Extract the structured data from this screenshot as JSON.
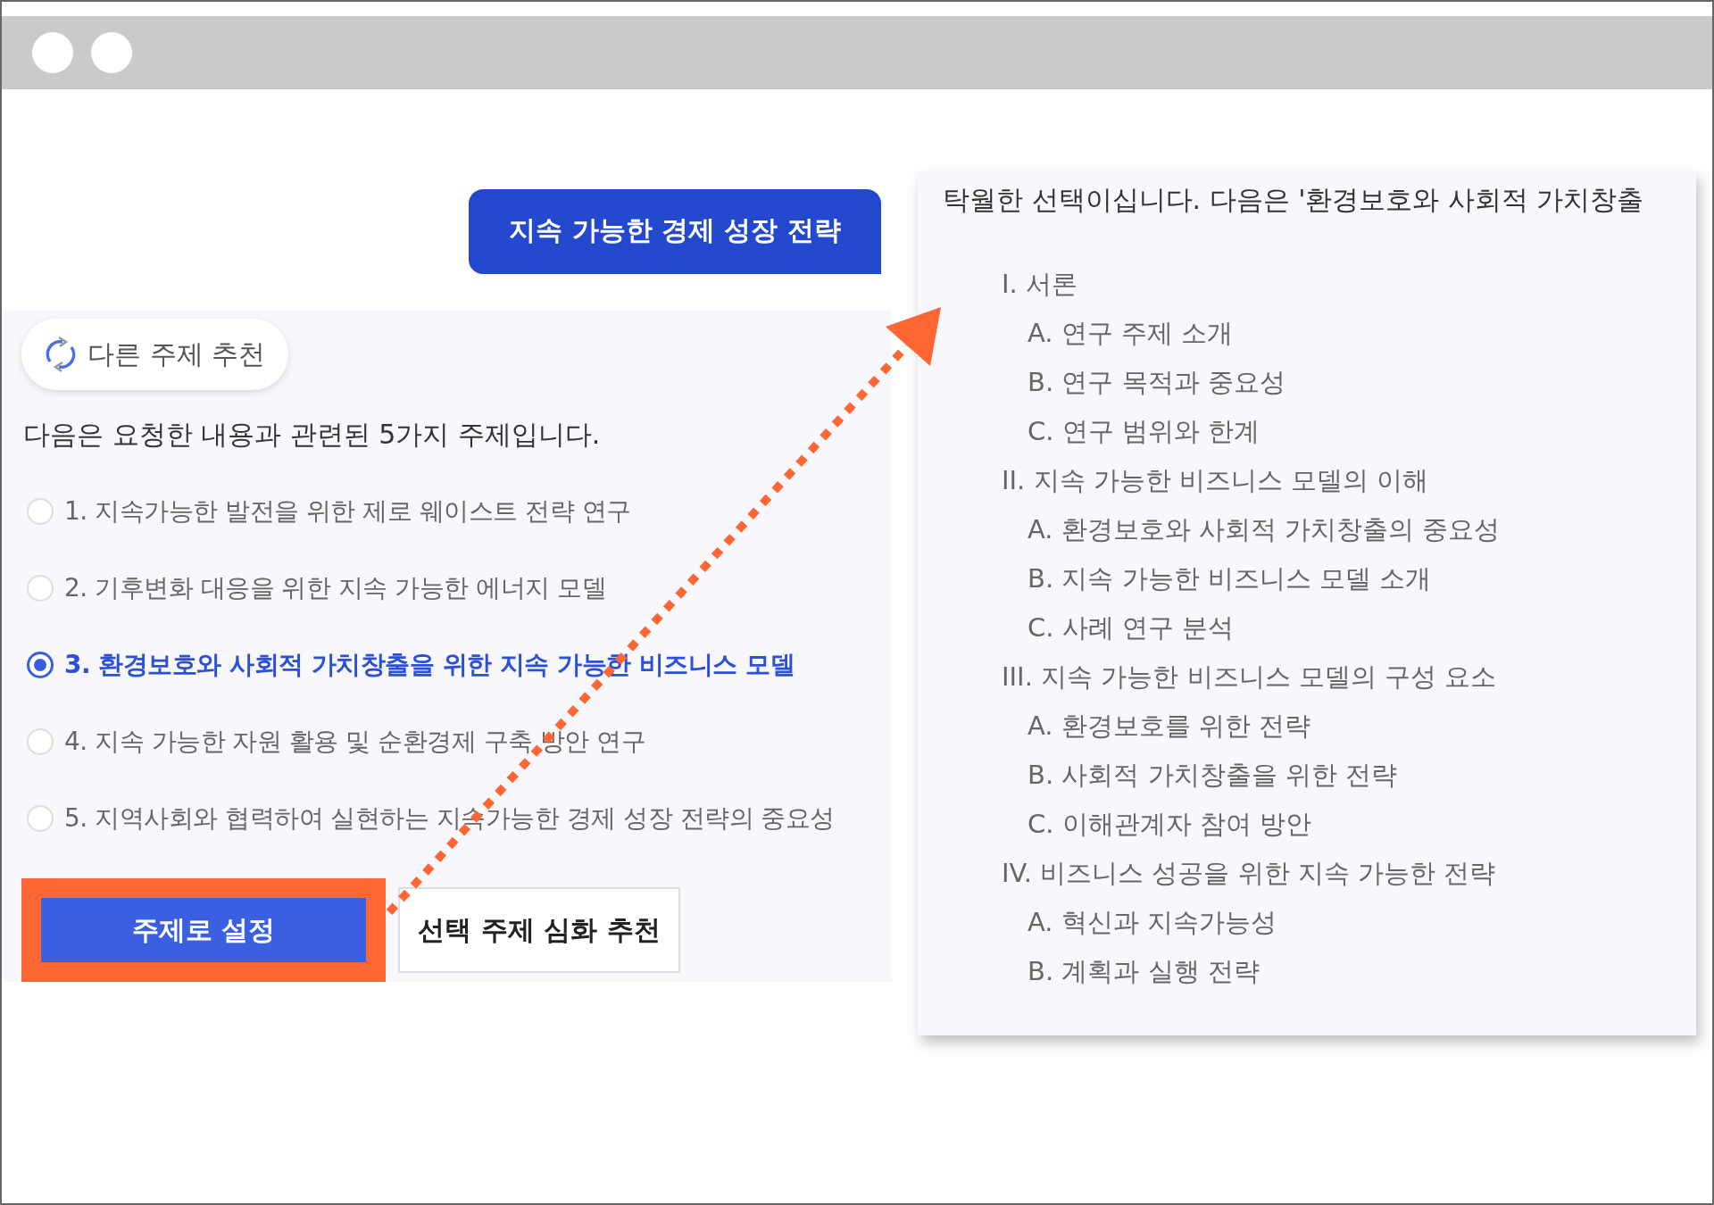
{
  "user_message": {
    "text": "지속 가능한 경제 성장 전략"
  },
  "topic_panel": {
    "refresh_button": "다른 주제 추천",
    "intro": "다음은 요청한 내용과 관련된 5가지 주제입니다.",
    "options": [
      {
        "label": "1. 지속가능한 발전을 위한 제로 웨이스트 전략 연구",
        "selected": false
      },
      {
        "label": "2. 기후변화 대응을 위한 지속 가능한 에너지 모델",
        "selected": false
      },
      {
        "label": "3. 환경보호와 사회적 가치창출을 위한 지속 가능한 비즈니스 모델",
        "selected": true
      },
      {
        "label": "4. 지속 가능한 자원 활용 및 순환경제 구축 방안 연구",
        "selected": false
      },
      {
        "label": "5. 지역사회와 협력하여 실현하는 지속가능한 경제 성장 전략의 중요성",
        "selected": false
      }
    ],
    "buttons": [
      {
        "label": "주제로 설정",
        "kind": "primary",
        "highlighted": true
      },
      {
        "label": "선택 주제 심화 추천",
        "kind": "secondary",
        "highlighted": false
      }
    ]
  },
  "outline_panel": {
    "intro": "탁월한 선택이십니다. 다음은 '환경보호와 사회적 가치창출",
    "outline": [
      {
        "label": "I. 서론",
        "children": [
          {
            "label": "A. 연구 주제 소개"
          },
          {
            "label": "B. 연구 목적과 중요성"
          },
          {
            "label": "C. 연구 범위와 한계"
          }
        ]
      },
      {
        "label": "II. 지속 가능한 비즈니스 모델의 이해",
        "children": [
          {
            "label": "A. 환경보호와 사회적 가치창출의 중요성"
          },
          {
            "label": "B. 지속 가능한 비즈니스 모델 소개"
          },
          {
            "label": "C. 사례 연구 분석"
          }
        ]
      },
      {
        "label": "III. 지속 가능한 비즈니스 모델의 구성 요소",
        "children": [
          {
            "label": "A. 환경보호를 위한 전략"
          },
          {
            "label": "B. 사회적 가치창출을 위한 전략"
          },
          {
            "label": "C. 이해관계자 참여 방안"
          }
        ]
      },
      {
        "label": "IV. 비즈니스 성공을 위한 지속 가능한 전략",
        "children": [
          {
            "label": "A. 혁신과 지속가능성"
          },
          {
            "label": "B. 계획과 실행 전략"
          }
        ]
      }
    ]
  }
}
